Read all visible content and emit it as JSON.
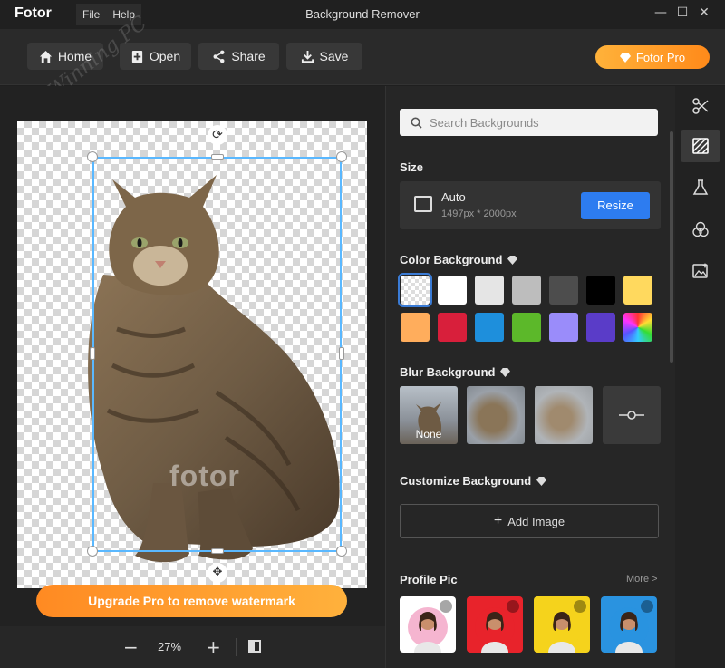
{
  "app": {
    "name": "Fotor",
    "window_title": "Background Remover",
    "menu": [
      "File",
      "Help"
    ]
  },
  "toolbar": {
    "home": "Home",
    "open": "Open",
    "share": "Share",
    "save": "Save",
    "pro": "Fotor Pro",
    "watermark_text": "Winning PC"
  },
  "canvas": {
    "watermark": "fotor",
    "upgrade": "Upgrade Pro to remove watermark",
    "zoom": "27%"
  },
  "panel": {
    "search_placeholder": "Search Backgrounds",
    "size": {
      "title": "Size",
      "label": "Auto",
      "dims": "1497px * 2000px",
      "button": "Resize"
    },
    "color_bg": {
      "title": "Color Background",
      "swatches": [
        "transparent",
        "#ffffff",
        "#e5e5e5",
        "#bdbdbd",
        "#4d4d4d",
        "#000000",
        "#ffd95e",
        "#ffad5c",
        "#d81f3b",
        "#1e8fdc",
        "#5cb82a",
        "#9a8cfa",
        "#5a3cc8",
        "rainbow"
      ]
    },
    "blur_bg": {
      "title": "Blur Background",
      "none": "None"
    },
    "custom_bg": {
      "title": "Customize Background",
      "add": "Add Image"
    },
    "profile": {
      "title": "Profile Pic",
      "more": "More >",
      "colors": [
        "#f5b5d0",
        "#e8232b",
        "#f5d31c",
        "#2a93e0"
      ]
    }
  },
  "strip": [
    "scissors-icon",
    "background-icon",
    "flask-icon",
    "circles-icon",
    "image-edit-icon"
  ],
  "colors": {
    "accent": "#2d7cf0",
    "pro": "#ff9a2a"
  }
}
